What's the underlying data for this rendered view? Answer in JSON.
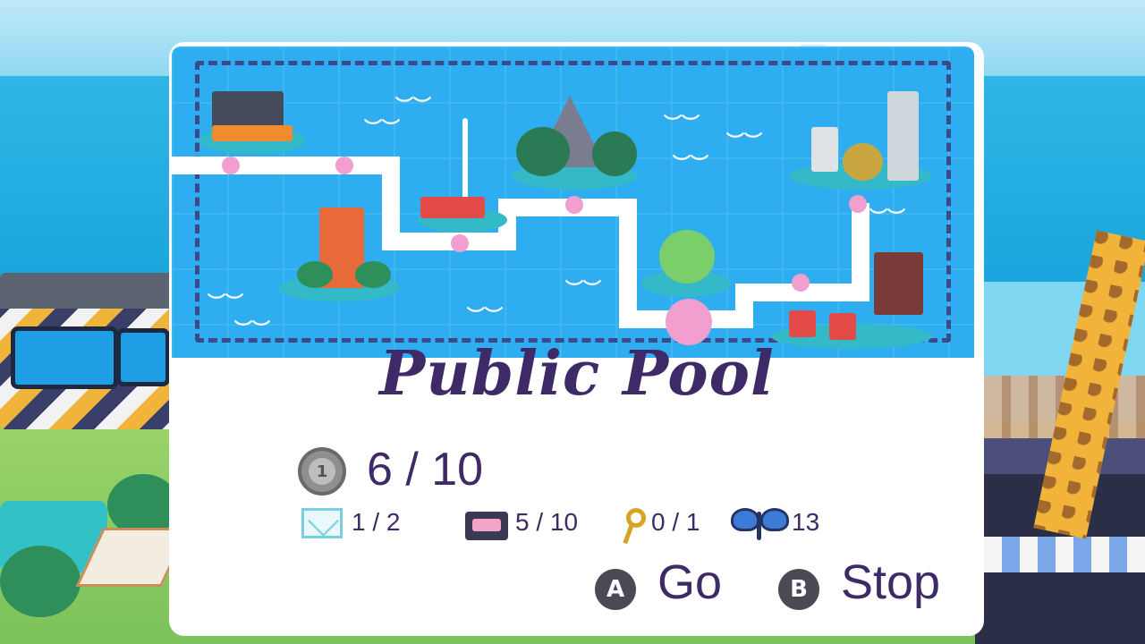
{
  "location_title": "Public Pool",
  "coins": {
    "value": "6 / 10",
    "coin_icon_label": "1"
  },
  "collectibles": {
    "letters": "1 / 2",
    "cassettes": "5 / 10",
    "keys": "0 / 1",
    "butterflies": "13"
  },
  "controls": {
    "go": {
      "button": "A",
      "label": "Go"
    },
    "stop": {
      "button": "B",
      "label": "Stop"
    }
  },
  "icons": [
    "coin-icon",
    "envelope-icon",
    "cassette-icon",
    "key-icon",
    "butterfly-icon"
  ],
  "colors": {
    "text": "#3e2a66",
    "map_water": "#2eaef0",
    "path_node": "#f29fcf",
    "panel": "#ffffff"
  }
}
